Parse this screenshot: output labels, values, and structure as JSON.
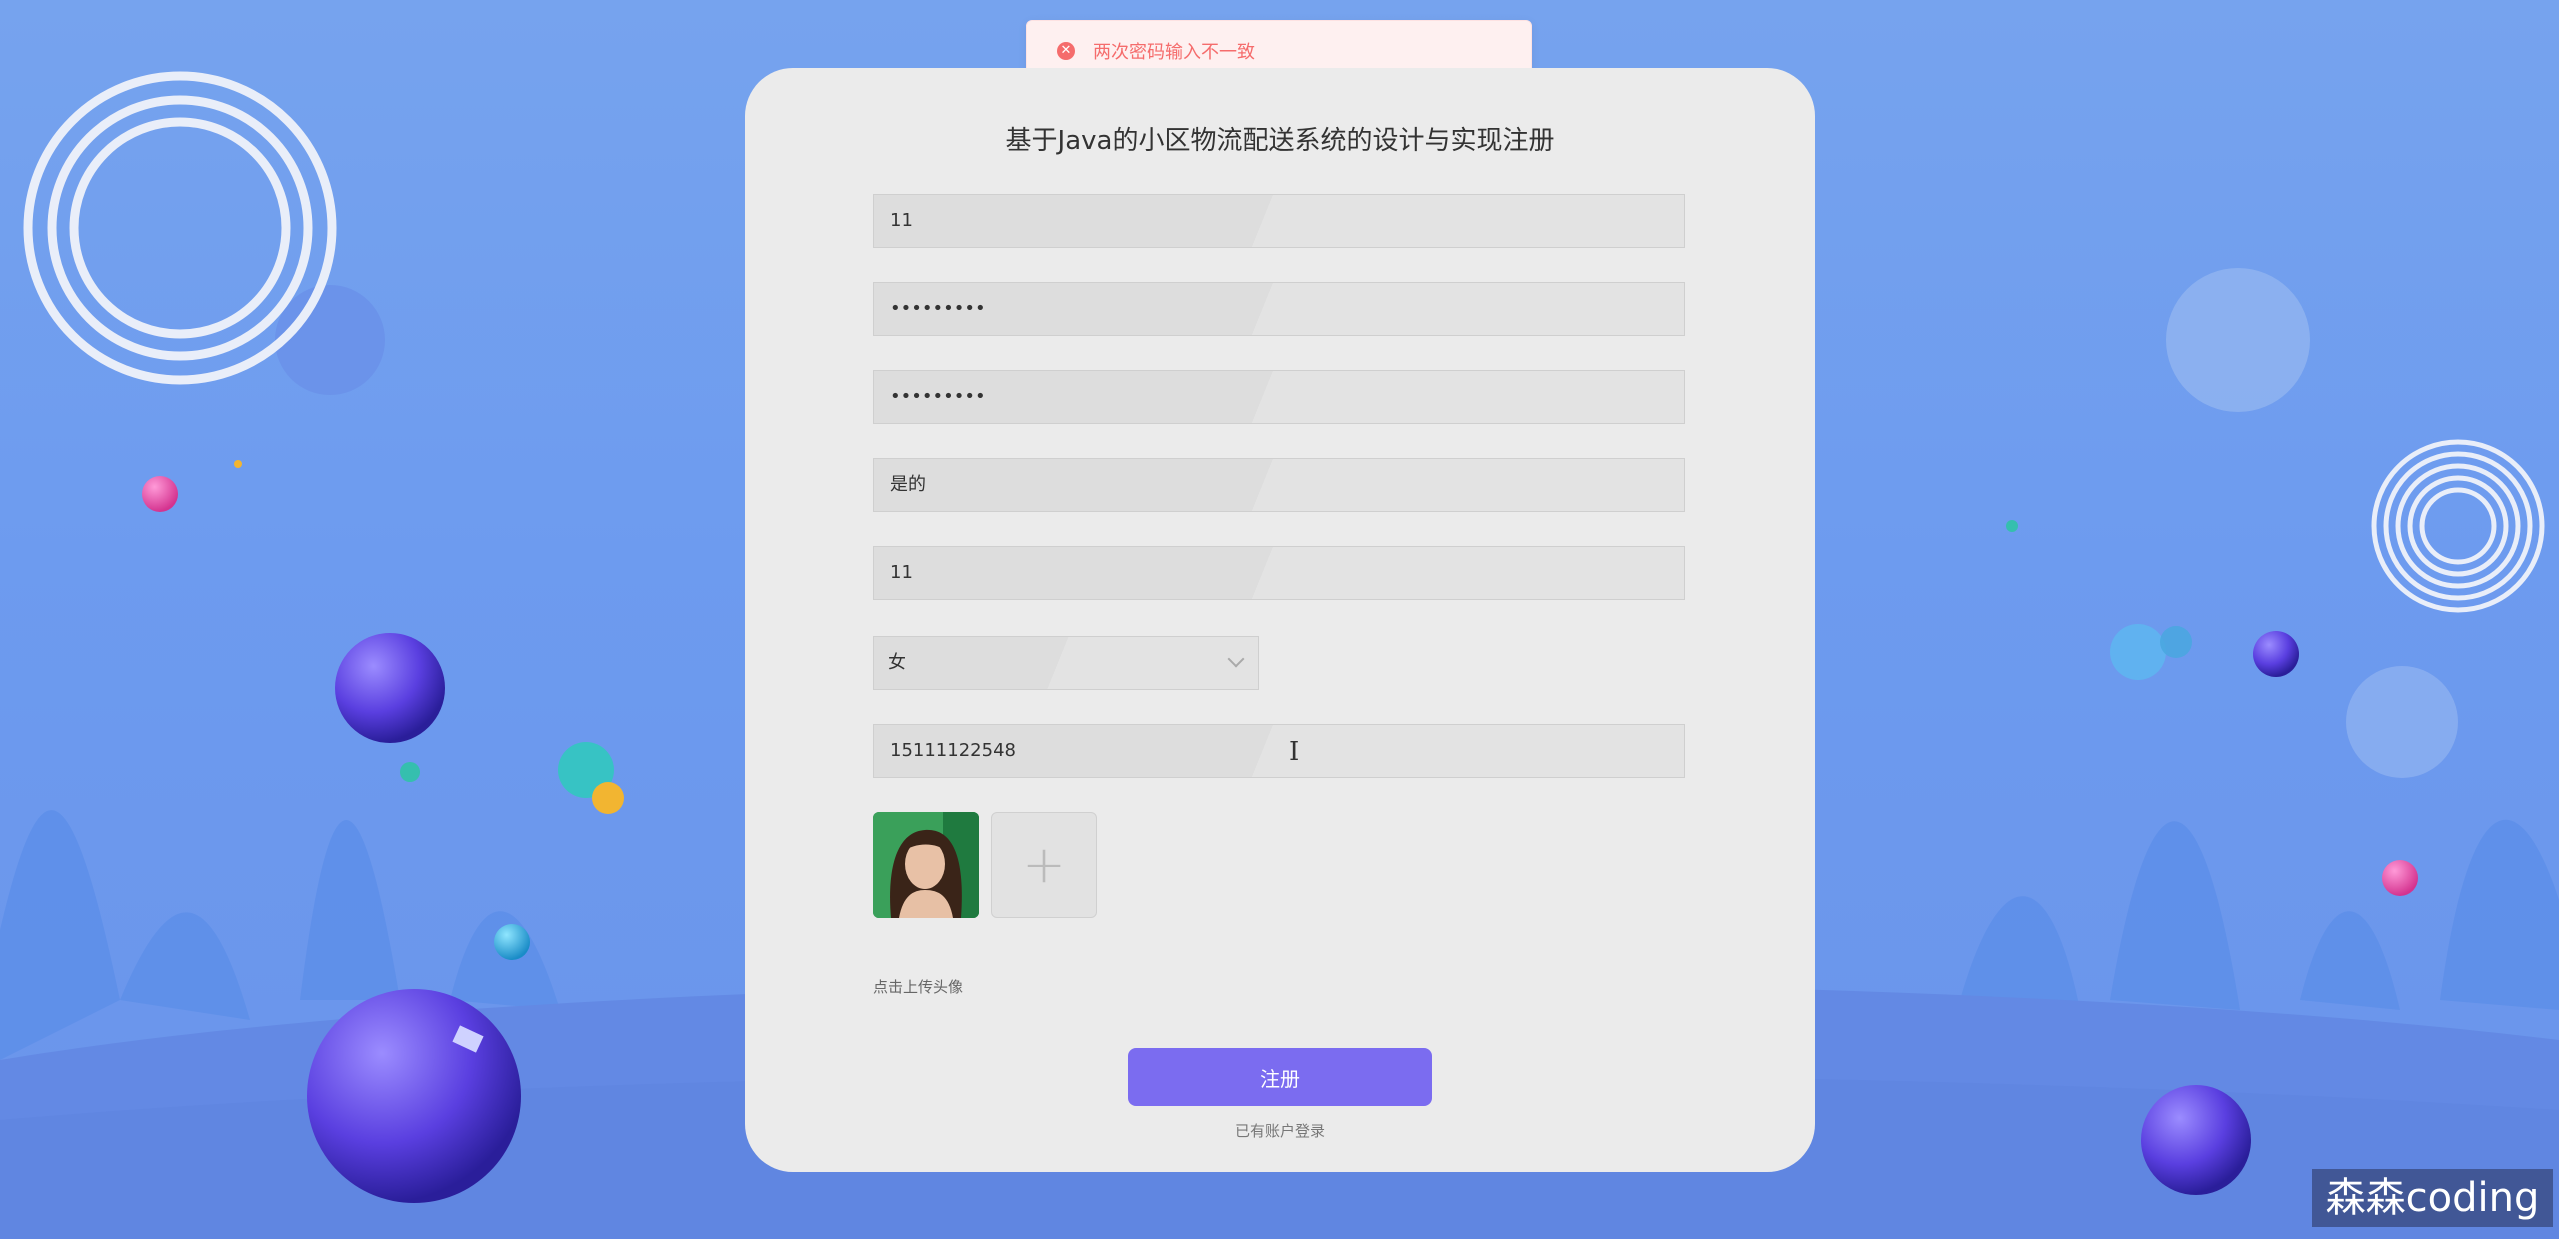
{
  "toast": {
    "icon": "error-circle-icon",
    "message": "两次密码输入不一致",
    "color": "#f56c6c"
  },
  "form": {
    "title": "基于Java的小区物流配送系统的设计与实现注册",
    "fields": [
      {
        "name": "account",
        "value": "11"
      },
      {
        "name": "password",
        "value": "•••••••••"
      },
      {
        "name": "confirm-password",
        "value": "•••••••••"
      },
      {
        "name": "name",
        "value": "是的"
      },
      {
        "name": "field-5",
        "value": "11"
      }
    ],
    "gender": {
      "selected": "女"
    },
    "phone": {
      "value": "15111122548"
    },
    "upload_hint": "点击上传头像",
    "submit_label": "注册",
    "login_link": "已有账户登录"
  },
  "watermark": "森森coding",
  "colors": {
    "accent": "#7b6cf0",
    "card": "#ebebeb",
    "background": "#6d9bef"
  }
}
